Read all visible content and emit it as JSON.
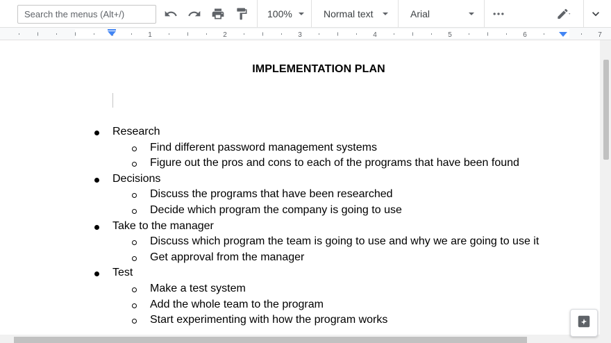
{
  "toolbar": {
    "search_placeholder": "Search the menus (Alt+/)",
    "zoom": "100%",
    "style": "Normal text",
    "font": "Arial",
    "icons": [
      "undo-icon",
      "redo-icon",
      "print-icon",
      "paint-format-icon",
      "more-icon",
      "edit-mode-icon",
      "collapse-icon"
    ]
  },
  "ruler": {
    "labels": [
      "1",
      "2",
      "3",
      "4",
      "5",
      "6",
      "7"
    ]
  },
  "document": {
    "title": "IMPLEMENTATION PLAN",
    "items": [
      {
        "level": 1,
        "text": "Research"
      },
      {
        "level": 2,
        "text": "Find different password management systems"
      },
      {
        "level": 2,
        "text": "Figure out the pros and cons to each of the programs that have been found"
      },
      {
        "level": 1,
        "text": "Decisions"
      },
      {
        "level": 2,
        "text": "Discuss the programs that have been researched"
      },
      {
        "level": 2,
        "text": "Decide which program the company is going to use"
      },
      {
        "level": 1,
        "text": "Take to the manager"
      },
      {
        "level": 2,
        "text": "Discuss which program the team is going to use and why we are going to use it"
      },
      {
        "level": 2,
        "text": "Get approval from the manager"
      },
      {
        "level": 1,
        "text": "Test"
      },
      {
        "level": 2,
        "text": "Make a test system"
      },
      {
        "level": 2,
        "text": "Add the whole team to the program"
      },
      {
        "level": 2,
        "text": "Start experimenting with how the program works"
      }
    ]
  },
  "colors": {
    "accent": "#4285f4",
    "icon": "#5f6368",
    "text": "#000000"
  }
}
